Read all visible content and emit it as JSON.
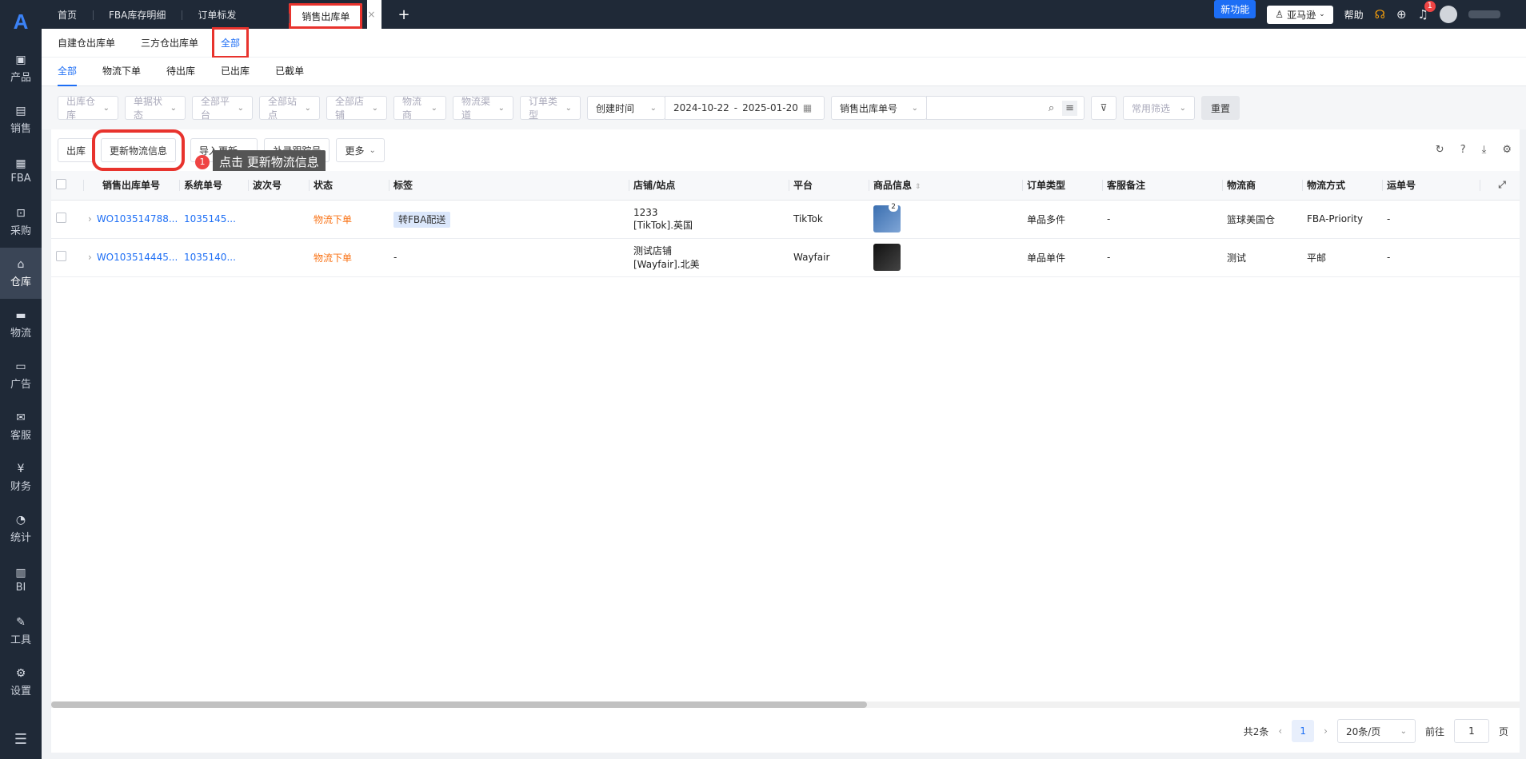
{
  "sidebar": {
    "logo": "A",
    "items": [
      {
        "icon": "package-icon",
        "glyph": "▣",
        "label": "产品"
      },
      {
        "icon": "sell-icon",
        "glyph": "▤",
        "label": "销售"
      },
      {
        "icon": "fba-icon",
        "glyph": "▦",
        "label": "FBA"
      },
      {
        "icon": "cart-icon",
        "glyph": "⊡",
        "label": "采购"
      },
      {
        "icon": "warehouse-icon",
        "glyph": "⌂",
        "label": "仓库"
      },
      {
        "icon": "truck-icon",
        "glyph": "▬",
        "label": "物流"
      },
      {
        "icon": "ad-icon",
        "glyph": "▭",
        "label": "广告"
      },
      {
        "icon": "mail-icon",
        "glyph": "✉",
        "label": "客服"
      },
      {
        "icon": "finance-icon",
        "glyph": "¥",
        "label": "财务"
      },
      {
        "icon": "pie-icon",
        "glyph": "◔",
        "label": "统计"
      },
      {
        "icon": "bi-icon",
        "glyph": "▥",
        "label": "BI"
      },
      {
        "icon": "wrench-icon",
        "glyph": "✎",
        "label": "工具"
      },
      {
        "icon": "gear-icon",
        "glyph": "⚙",
        "label": "设置"
      }
    ],
    "active_index": 4,
    "menu_glyph": "☰"
  },
  "tabs": [
    {
      "label": "首页"
    },
    {
      "label": "FBA库存明细"
    },
    {
      "label": "订单标发"
    },
    {
      "label": "销售出库单"
    }
  ],
  "tab_close": "×",
  "tab_add": "+",
  "topright": {
    "new_feature": "新功能",
    "marketplace": "亚马逊",
    "help": "帮助",
    "notify_count": "1"
  },
  "subnav": [
    "自建仓出库单",
    "三方仓出库单",
    "全部"
  ],
  "statusnav": [
    "全部",
    "物流下单",
    "待出库",
    "已出库",
    "已截单"
  ],
  "filters": {
    "selects": [
      {
        "label": "出库仓库",
        "w": 76
      },
      {
        "label": "单据状态",
        "w": 76
      },
      {
        "label": "全部平台",
        "w": 76
      },
      {
        "label": "全部站点",
        "w": 76
      },
      {
        "label": "全部店铺",
        "w": 76
      },
      {
        "label": "物流商",
        "w": 66
      },
      {
        "label": "物流渠道",
        "w": 76
      },
      {
        "label": "订单类型",
        "w": 76
      }
    ],
    "time_type": "创建时间",
    "date_start": "2024-10-22",
    "date_sep": "-",
    "date_end": "2025-01-20",
    "search_type": "销售出库单号",
    "common_filter": "常用筛选",
    "reset": "重置"
  },
  "toolbar": {
    "outbound": "出库",
    "update_logistics": "更新物流信息",
    "import_update": "导入更新",
    "add_tracking": "补录跟踪号",
    "more": "更多",
    "tip_number": "1",
    "tip_text": "点击 更新物流信息"
  },
  "table": {
    "headers": [
      "销售出库单号",
      "系统单号",
      "波次号",
      "状态",
      "标签",
      "店铺/站点",
      "平台",
      "商品信息",
      "订单类型",
      "客服备注",
      "物流商",
      "物流方式",
      "运单号"
    ],
    "rows": [
      {
        "order_no": "WO103514788...",
        "sys_no": "1035145...",
        "wave": "",
        "status": "物流下单",
        "tag": "转FBA配送",
        "shop1": "1233",
        "shop2": "[TikTok].英国",
        "platform": "TikTok",
        "thumb": "blue",
        "thumb_count": "2",
        "order_type": "单品多件",
        "remark": "-",
        "carrier": "篮球美国仓",
        "method": "FBA-Priority",
        "waybill": "-"
      },
      {
        "order_no": "WO103514445...",
        "sys_no": "1035140...",
        "wave": "",
        "status": "物流下单",
        "tag": "-",
        "shop1": "测试店铺",
        "shop2": "[Wayfair].北美",
        "platform": "Wayfair",
        "thumb": "dark",
        "thumb_count": "",
        "order_type": "单品单件",
        "remark": "-",
        "carrier": "测试",
        "method": "平邮",
        "waybill": "-"
      }
    ]
  },
  "pager": {
    "total": "共2条",
    "page": "1",
    "page_size": "20条/页",
    "goto_label": "前往",
    "goto_value": "1",
    "page_unit": "页"
  }
}
